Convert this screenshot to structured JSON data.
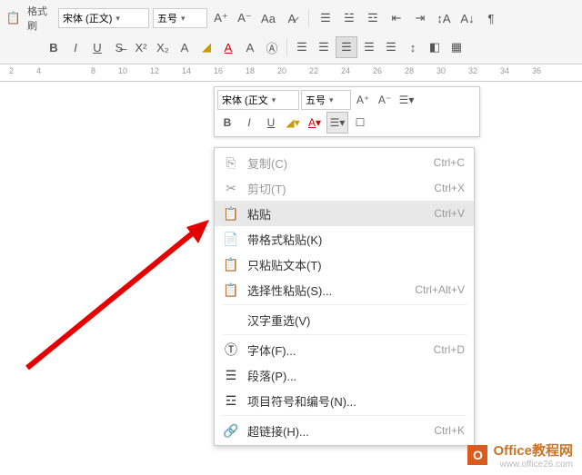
{
  "toolbar": {
    "format_brush": "格式刷",
    "font_name": "宋体 (正文)",
    "font_size": "五号"
  },
  "ruler": {
    "nums": [
      "2",
      "4",
      "8",
      "10",
      "12",
      "14",
      "16",
      "18",
      "20",
      "22",
      "24",
      "26",
      "28",
      "30",
      "32",
      "34",
      "36"
    ]
  },
  "mini_toolbar": {
    "font_name": "宋体 (正文",
    "font_size": "五号"
  },
  "menu": {
    "copy": {
      "label": "复制(C)",
      "shortcut": "Ctrl+C"
    },
    "cut": {
      "label": "剪切(T)",
      "shortcut": "Ctrl+X"
    },
    "paste": {
      "label": "粘贴",
      "shortcut": "Ctrl+V"
    },
    "paste_fmt": {
      "label": "带格式粘贴(K)",
      "shortcut": ""
    },
    "paste_text": {
      "label": "只粘贴文本(T)",
      "shortcut": ""
    },
    "paste_special": {
      "label": "选择性粘贴(S)...",
      "shortcut": "Ctrl+Alt+V"
    },
    "reconvert": {
      "label": "汉字重选(V)",
      "shortcut": ""
    },
    "font": {
      "label": "字体(F)...",
      "shortcut": "Ctrl+D"
    },
    "paragraph": {
      "label": "段落(P)...",
      "shortcut": ""
    },
    "bullets": {
      "label": "项目符号和编号(N)...",
      "shortcut": ""
    },
    "hyperlink": {
      "label": "超链接(H)...",
      "shortcut": "Ctrl+K"
    }
  },
  "watermark": {
    "text": "Office教程网",
    "url": "www.office26.com"
  }
}
